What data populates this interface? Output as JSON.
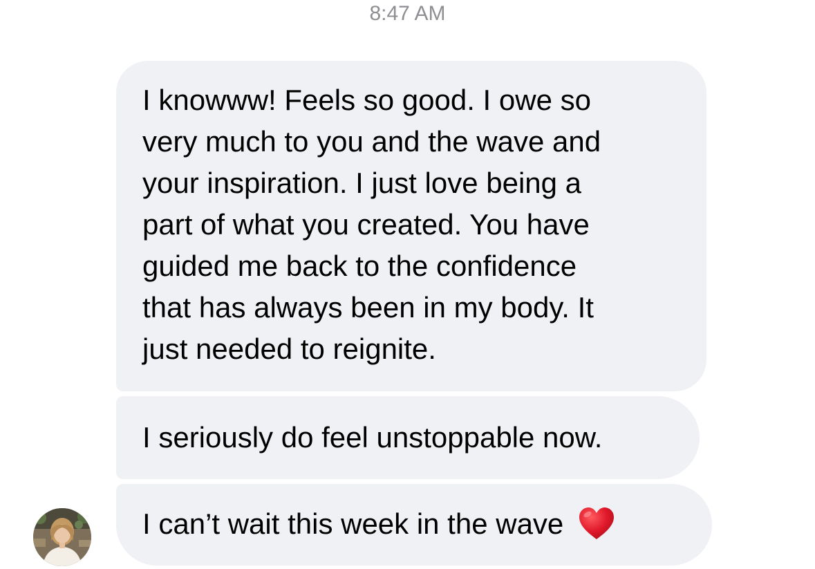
{
  "thread": {
    "timestamp": "8:47 AM"
  },
  "messages": [
    {
      "lines": [
        "I knowww! Feels so good. I owe so",
        "very much to you and the wave and",
        "your inspiration. I just love being a",
        "part of what you created. You have",
        "guided me back to the confidence",
        "that has always been in my body. It",
        "just needed to reignite."
      ]
    },
    {
      "lines": [
        "I seriously do feel unstoppable now."
      ]
    },
    {
      "lines": [
        "I can’t wait this week in the wave"
      ],
      "emoji": "red-heart-icon"
    }
  ],
  "colors": {
    "bubble_background": "#f0f1f4",
    "timestamp_text": "#8e8e93",
    "heart": "#e0192a"
  },
  "avatar": {
    "icon": "contact-photo-avatar"
  }
}
